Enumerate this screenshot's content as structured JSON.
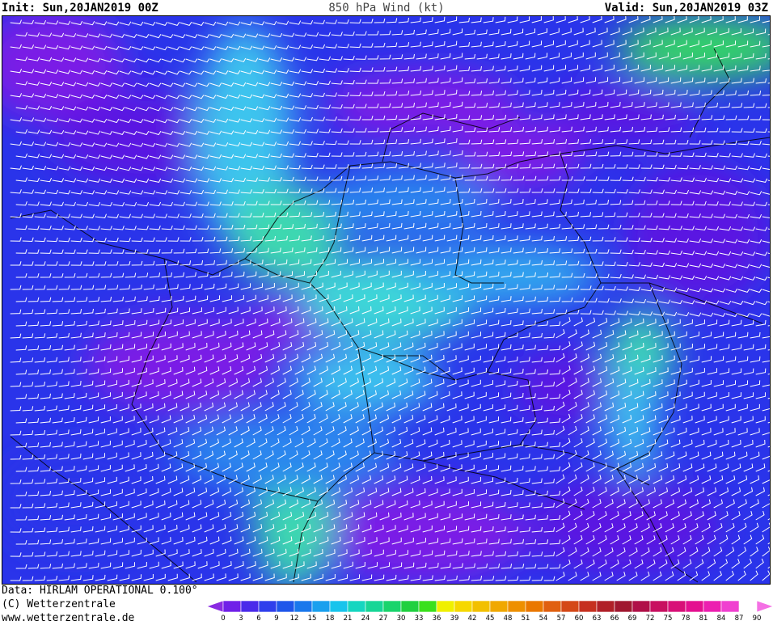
{
  "header": {
    "init_label": "Init: Sun,20JAN2019 00Z",
    "title": "850 hPa Wind (kt)",
    "valid_label": "Valid: Sun,20JAN2019 03Z"
  },
  "footer": {
    "data_source": "Data: HIRLAM OPERATIONAL 0.100°",
    "copyright": "(C) Wetterzentrale",
    "website": "www.wetterzentrale.de"
  },
  "legend": {
    "ticks": [
      "0",
      "3",
      "6",
      "9",
      "12",
      "15",
      "18",
      "21",
      "24",
      "27",
      "30",
      "33",
      "36",
      "39",
      "42",
      "45",
      "48",
      "51",
      "54",
      "57",
      "60",
      "63",
      "66",
      "69",
      "72",
      "75",
      "78",
      "81",
      "84",
      "87",
      "90"
    ],
    "colors": [
      "#8a2be2",
      "#7020e8",
      "#4a2aea",
      "#2f3fec",
      "#1f56ea",
      "#1a78ec",
      "#1aa0ee",
      "#18c4ec",
      "#16d6c0",
      "#18d696",
      "#1ad46c",
      "#20d040",
      "#3ae01c",
      "#f0f000",
      "#f6d800",
      "#f2c000",
      "#f0a800",
      "#ee9000",
      "#ea7800",
      "#e06010",
      "#d44818",
      "#c63020",
      "#b02028",
      "#a01830",
      "#b01048",
      "#c81060",
      "#d81078",
      "#e41090",
      "#ec20b0",
      "#f040d0",
      "#f470e4"
    ],
    "shades": [
      "#7a1fe6",
      "#5a18e2",
      "#3c24e6",
      "#2a34ea",
      "#1e4aea",
      "#1f66ee",
      "#2a86ee",
      "#32a6ee",
      "#3cc4ee",
      "#3ed6d8",
      "#3cd8b0",
      "#3ad88a",
      "#36d468"
    ],
    "map_background": "#2a34ea"
  }
}
